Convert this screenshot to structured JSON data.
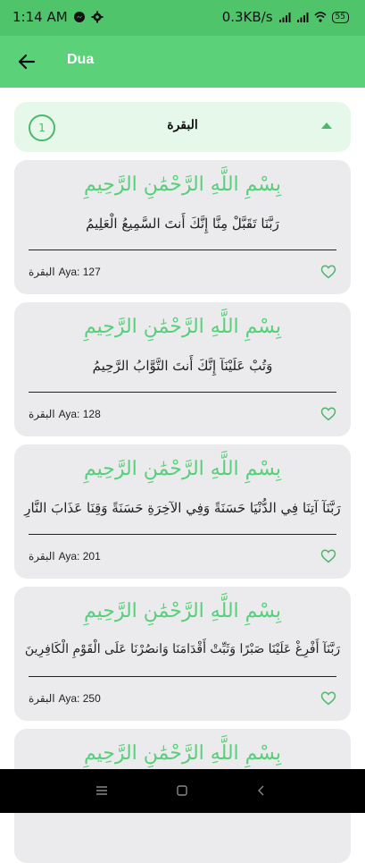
{
  "status": {
    "time": "1:14 AM",
    "network": "0.3KB/s",
    "battery": "55"
  },
  "appbar": {
    "title": "Dua"
  },
  "surah": {
    "number": "1",
    "name": "البقرة"
  },
  "cards": [
    {
      "bismillah": "بِسْمِ اللَّهِ الرَّحْمَٰنِ الرَّحِيمِ",
      "text": "رَبَّنَا تَقَبَّلْ مِنَّا إِنَّكَ أَنتَ السَّمِيعُ الْعَلِيمُ",
      "surah": "البقرة",
      "aya": "Aya: 127"
    },
    {
      "bismillah": "بِسْمِ اللَّهِ الرَّحْمَٰنِ الرَّحِيمِ",
      "text": "وَتُبْ عَلَيْنَآ إِنَّكَ أَنتَ التَّوَّابُ الرَّحِيمُ",
      "surah": "البقرة",
      "aya": "Aya: 128"
    },
    {
      "bismillah": "بِسْمِ اللَّهِ الرَّحْمَٰنِ الرَّحِيمِ",
      "text": "رَبَّنَآ آتِنَا فِي الدُّنْيَا حَسَنَةً وَفِي الآخِرَةِ حَسَنَةً وَقِنَا عَذَابَ النَّارِ",
      "surah": "البقرة",
      "aya": "Aya: 201"
    },
    {
      "bismillah": "بِسْمِ اللَّهِ الرَّحْمَٰنِ الرَّحِيمِ",
      "text": "رَبَّنَآ أَفْرِغْ عَلَيْنَا صَبْرًا وَثَبِّتْ أَقْدَامَنَا وَانصُرْنَا عَلَى الْقَوْمِ الْكَافِرِينَ",
      "surah": "البقرة",
      "aya": "Aya: 250"
    },
    {
      "bismillah": "بِسْمِ اللَّهِ الرَّحْمَٰنِ الرَّحِيمِ"
    }
  ],
  "colors": {
    "accent": "#5bd27a",
    "status_bar": "#4fc46b",
    "header_bg": "#e5f8e9",
    "card_bg": "#ebebee"
  }
}
